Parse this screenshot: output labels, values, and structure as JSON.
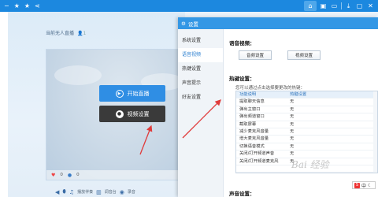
{
  "topbar": {
    "left_icons": [
      "minus-icon",
      "star-icon",
      "star-icon",
      "share-icon"
    ],
    "right_icons": [
      "home-icon",
      "image-icon",
      "monitor-icon",
      "download-icon",
      "window-icon",
      "close-icon"
    ]
  },
  "live": {
    "title": "当前无人直播",
    "count": "1",
    "start_label": "开始直播",
    "video_settings_label": "视频设置",
    "likes": "0",
    "viewers": "0"
  },
  "bottombar": [
    "播放伴奏",
    "调音台",
    "录音"
  ],
  "dialog": {
    "title": "设置",
    "sidebar": [
      {
        "label": "系统设置",
        "active": false
      },
      {
        "label": "语音视频",
        "active": true
      },
      {
        "label": "热键设置",
        "active": false
      },
      {
        "label": "声音提示",
        "active": false
      },
      {
        "label": "好友设置",
        "active": false
      }
    ],
    "video_section": "语音视频：",
    "audio_btn": "音频设置",
    "video_btn": "视频设置",
    "hotkey_section": "热键设置：",
    "hint": "您可以通过点击选择要更改的热键：",
    "table_header": {
      "c1": "功能说明",
      "c2": "热键设置"
    },
    "table_rows": [
      {
        "c1": "提取聊天信息",
        "c2": "无"
      },
      {
        "c1": "弹出主窗口",
        "c2": "无"
      },
      {
        "c1": "弹出频道窗口",
        "c2": "无"
      },
      {
        "c1": "截取屏幕",
        "c2": "无"
      },
      {
        "c1": "减少麦克风音量",
        "c2": "无"
      },
      {
        "c1": "增大麦克风音量",
        "c2": "无"
      },
      {
        "c1": "切换语音模式",
        "c2": "无"
      },
      {
        "c1": "关闭/打开频道声音",
        "c2": "无"
      },
      {
        "c1": "关闭/打开频道麦克风",
        "c2": "无"
      }
    ],
    "voice_section": "声音设置："
  },
  "tray": {
    "label": "中"
  },
  "colors": {
    "accent": "#1c88df",
    "arrow": "#e03a3a"
  }
}
